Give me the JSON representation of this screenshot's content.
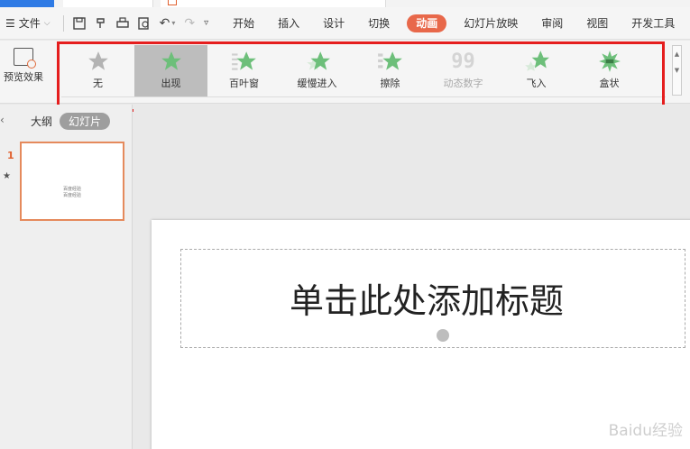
{
  "menubar": {
    "file_label": "文件",
    "tabs": [
      "开始",
      "插入",
      "设计",
      "切换",
      "动画",
      "幻灯片放映",
      "审阅",
      "视图",
      "开发工具"
    ]
  },
  "ribbon": {
    "preview_label": "预览效果",
    "effects": [
      {
        "label": "无",
        "icon": "grey-star-icon"
      },
      {
        "label": "出现",
        "icon": "green-star-icon"
      },
      {
        "label": "百叶窗",
        "icon": "blinds-star-icon"
      },
      {
        "label": "缓慢进入",
        "icon": "crawl-star-icon"
      },
      {
        "label": "擦除",
        "icon": "wipe-star-icon"
      },
      {
        "label": "动态数字",
        "icon": "number-99-icon"
      },
      {
        "label": "飞入",
        "icon": "fly-star-icon"
      },
      {
        "label": "盒状",
        "icon": "box-star-icon"
      }
    ],
    "selected_effect": "出现"
  },
  "left_pane": {
    "outline_label": "大纲",
    "slides_label": "幻灯片",
    "slide_number": "1",
    "thumb_line1": "百度经验",
    "thumb_line2": "百度经验"
  },
  "slide": {
    "title_placeholder": "单击此处添加标题",
    "watermark": "Baidu经验"
  },
  "colors": {
    "accent": "#e8684a",
    "highlight_box": "#e51e1e",
    "star_green": "#6dbf7a"
  }
}
